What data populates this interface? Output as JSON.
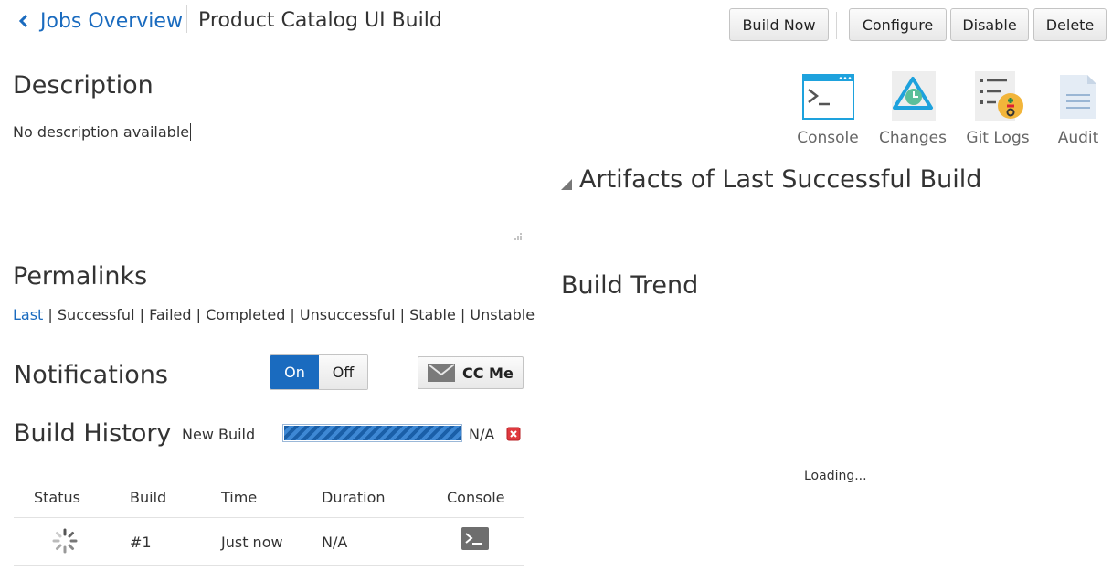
{
  "header": {
    "back_label": "Jobs Overview",
    "job_title": "Product Catalog UI Build"
  },
  "toolbar": {
    "build_now": "Build Now",
    "configure": "Configure",
    "disable": "Disable",
    "delete": "Delete"
  },
  "description": {
    "title": "Description",
    "text": "No description available"
  },
  "quick_links": [
    {
      "label": "Console",
      "icon": "console-icon"
    },
    {
      "label": "Changes",
      "icon": "changes-icon"
    },
    {
      "label": "Git Logs",
      "icon": "git-logs-icon"
    },
    {
      "label": "Audit",
      "icon": "audit-icon"
    }
  ],
  "artifacts": {
    "title": "Artifacts of Last Successful Build"
  },
  "permalinks": {
    "title": "Permalinks",
    "items": [
      "Last",
      "Successful",
      "Failed",
      "Completed",
      "Unsuccessful",
      "Stable",
      "Unstable"
    ],
    "separator": "|"
  },
  "notifications": {
    "title": "Notifications",
    "on_label": "On",
    "off_label": "Off",
    "selected": "On",
    "cc_label": "CC Me"
  },
  "build_history": {
    "title": "Build History",
    "new_build_label": "New Build",
    "progress_value": "N/A",
    "columns": [
      "Status",
      "Build",
      "Time",
      "Duration",
      "Console"
    ],
    "rows": [
      {
        "build": "#1",
        "time": "Just now",
        "duration": "N/A"
      }
    ]
  },
  "build_trend": {
    "title": "Build Trend",
    "loading": "Loading..."
  },
  "colors": {
    "accent": "#1a6bbf",
    "cancel": "#e0393e"
  }
}
